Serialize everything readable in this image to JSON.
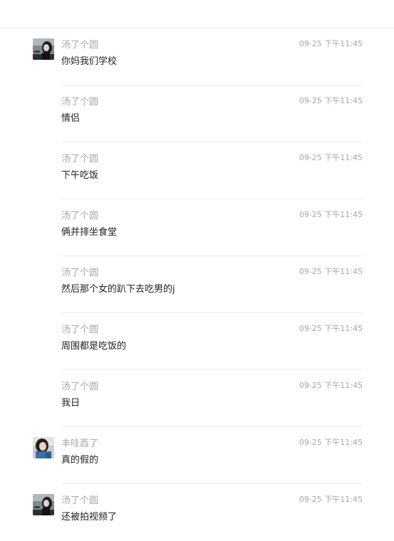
{
  "messages": [
    {
      "sender": "汤了个圆",
      "time": "09-25 下午11:45",
      "content": "你妈我们学校",
      "avatar": "avatar-girl-dark"
    },
    {
      "sender": "汤了个圆",
      "time": "09-25 下午11:45",
      "content": "情侣",
      "avatar": ""
    },
    {
      "sender": "汤了个圆",
      "time": "09-25 下午11:45",
      "content": "下午吃饭",
      "avatar": ""
    },
    {
      "sender": "汤了个圆",
      "time": "09-25 下午11:45",
      "content": "俩并排坐食堂",
      "avatar": ""
    },
    {
      "sender": "汤了个圆",
      "time": "09-25 下午11:45",
      "content": "然后那个女的趴下去吃男的j",
      "avatar": ""
    },
    {
      "sender": "汤了个圆",
      "time": "09-25 下午11:45",
      "content": "周围都是吃饭的",
      "avatar": ""
    },
    {
      "sender": "汤了个圆",
      "time": "09-25 下午11:45",
      "content": "我日",
      "avatar": ""
    },
    {
      "sender": "丰哇酉了",
      "time": "09-25 下午11:45",
      "content": "真的假的",
      "avatar": "avatar-girl-blue"
    },
    {
      "sender": "汤了个圆",
      "time": "09-25 下午11:45",
      "content": "还被拍视频了",
      "avatar": "avatar-girl-dark"
    }
  ]
}
